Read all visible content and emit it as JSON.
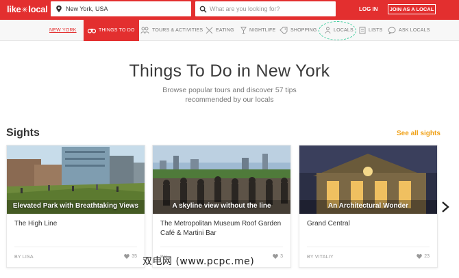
{
  "header": {
    "logo_pre": "like",
    "logo_post": "local",
    "location_value": "New York, USA",
    "search_placeholder": "What are you looking for?",
    "login_label": "LOG IN",
    "join_label": "JOIN AS A LOCAL",
    "brand_color": "#e32f2f"
  },
  "nav": {
    "city": "NEW YORK",
    "items": [
      {
        "label": "THINGS TO DO",
        "icon": "binoculars-icon"
      },
      {
        "label": "TOURS & ACTIVITIES",
        "icon": "people-icon"
      },
      {
        "label": "EATING",
        "icon": "cutlery-icon"
      },
      {
        "label": "NIGHTLIFE",
        "icon": "cocktail-icon"
      },
      {
        "label": "SHOPPING",
        "icon": "tag-icon"
      },
      {
        "label": "LOCALS",
        "icon": "person-icon"
      },
      {
        "label": "LISTS",
        "icon": "list-icon"
      },
      {
        "label": "ASK LOCALS",
        "icon": "chat-icon"
      }
    ]
  },
  "hero": {
    "title": "Things To Do in New York",
    "subtitle_line1": "Browse popular tours and discover 57 tips",
    "subtitle_line2": "recommended by our locals"
  },
  "sights": {
    "title": "Sights",
    "see_all": "See all sights",
    "accent_color": "#f0a21a",
    "cards": [
      {
        "caption": "Elevated Park with Breathtaking Views",
        "name": "The High Line",
        "by": "BY LISA",
        "likes": "35"
      },
      {
        "caption": "A skyline view without the line",
        "name": "The Metropolitan Museum Roof Garden Café & Martini Bar",
        "by": "BY",
        "likes": "3"
      },
      {
        "caption": "An Architectural Wonder",
        "name": "Grand Central",
        "by": "BY VITALIY",
        "likes": "23"
      }
    ]
  },
  "watermark": "双电网 (www.pcpc.me)"
}
